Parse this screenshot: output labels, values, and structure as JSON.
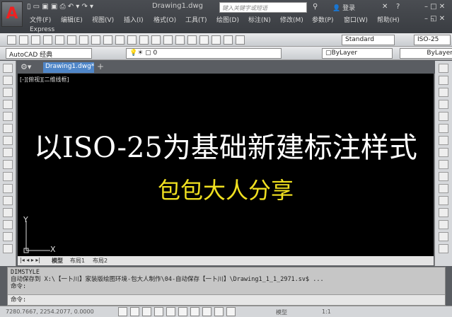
{
  "titlebar": {
    "doc_title": "Drawing1.dwg",
    "search_placeholder": "键入关键字或短语",
    "login": "登录"
  },
  "menu": [
    "文件(F)",
    "编辑(E)",
    "视图(V)",
    "插入(I)",
    "格式(O)",
    "工具(T)",
    "绘图(D)",
    "标注(N)",
    "修改(M)",
    "参数(P)",
    "窗口(W)",
    "帮助(H)"
  ],
  "express": "Express",
  "toolbar": {
    "text_style": "Standard",
    "dim_style": "ISO-25",
    "workspace": "AutoCAD 经典",
    "layer": "0",
    "color": "ByLayer",
    "linetype": "ByLayer"
  },
  "tabs": {
    "doc_tab": "Drawing1.dwg*",
    "add": "+"
  },
  "canvas": {
    "view_label": "[-][俯视][二维线框]",
    "title": "以ISO-25为基础新建标注样式",
    "subtitle": "包包大人分享",
    "ucs_x": "X",
    "ucs_y": "Y"
  },
  "layout_tabs": [
    "模型",
    "布局1",
    "布局2"
  ],
  "command": {
    "lines": [
      "DIMSTYLE",
      "自动保存到 X:\\【一卜川】家装版绘图环境-包大人制作\\04-自动保存【一卜川】\\Drawing1_1_1_2971.sv$ ...",
      "命令:"
    ],
    "prompt": "命令:"
  },
  "status": {
    "coords": "7280.7667, 2254.2077, 0.0000",
    "model": "模型",
    "scale": "1:1"
  }
}
